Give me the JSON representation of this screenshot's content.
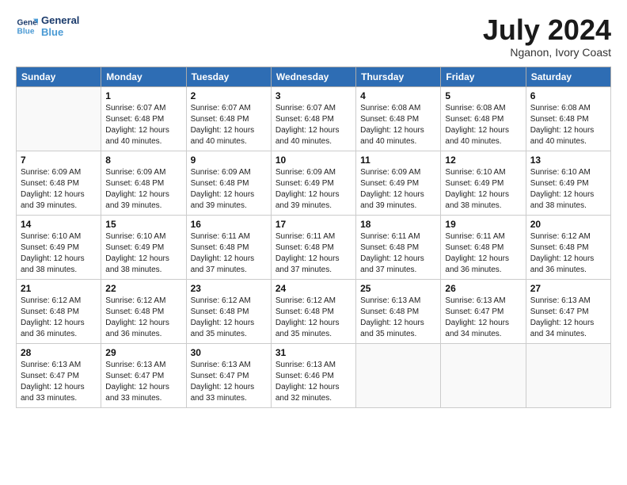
{
  "header": {
    "logo_line1": "General",
    "logo_line2": "Blue",
    "month": "July 2024",
    "location": "Nganon, Ivory Coast"
  },
  "weekdays": [
    "Sunday",
    "Monday",
    "Tuesday",
    "Wednesday",
    "Thursday",
    "Friday",
    "Saturday"
  ],
  "weeks": [
    [
      {
        "day": "",
        "info": ""
      },
      {
        "day": "1",
        "info": "Sunrise: 6:07 AM\nSunset: 6:48 PM\nDaylight: 12 hours\nand 40 minutes."
      },
      {
        "day": "2",
        "info": "Sunrise: 6:07 AM\nSunset: 6:48 PM\nDaylight: 12 hours\nand 40 minutes."
      },
      {
        "day": "3",
        "info": "Sunrise: 6:07 AM\nSunset: 6:48 PM\nDaylight: 12 hours\nand 40 minutes."
      },
      {
        "day": "4",
        "info": "Sunrise: 6:08 AM\nSunset: 6:48 PM\nDaylight: 12 hours\nand 40 minutes."
      },
      {
        "day": "5",
        "info": "Sunrise: 6:08 AM\nSunset: 6:48 PM\nDaylight: 12 hours\nand 40 minutes."
      },
      {
        "day": "6",
        "info": "Sunrise: 6:08 AM\nSunset: 6:48 PM\nDaylight: 12 hours\nand 40 minutes."
      }
    ],
    [
      {
        "day": "7",
        "info": "Sunrise: 6:09 AM\nSunset: 6:48 PM\nDaylight: 12 hours\nand 39 minutes."
      },
      {
        "day": "8",
        "info": "Sunrise: 6:09 AM\nSunset: 6:48 PM\nDaylight: 12 hours\nand 39 minutes."
      },
      {
        "day": "9",
        "info": "Sunrise: 6:09 AM\nSunset: 6:48 PM\nDaylight: 12 hours\nand 39 minutes."
      },
      {
        "day": "10",
        "info": "Sunrise: 6:09 AM\nSunset: 6:49 PM\nDaylight: 12 hours\nand 39 minutes."
      },
      {
        "day": "11",
        "info": "Sunrise: 6:09 AM\nSunset: 6:49 PM\nDaylight: 12 hours\nand 39 minutes."
      },
      {
        "day": "12",
        "info": "Sunrise: 6:10 AM\nSunset: 6:49 PM\nDaylight: 12 hours\nand 38 minutes."
      },
      {
        "day": "13",
        "info": "Sunrise: 6:10 AM\nSunset: 6:49 PM\nDaylight: 12 hours\nand 38 minutes."
      }
    ],
    [
      {
        "day": "14",
        "info": "Sunrise: 6:10 AM\nSunset: 6:49 PM\nDaylight: 12 hours\nand 38 minutes."
      },
      {
        "day": "15",
        "info": "Sunrise: 6:10 AM\nSunset: 6:49 PM\nDaylight: 12 hours\nand 38 minutes."
      },
      {
        "day": "16",
        "info": "Sunrise: 6:11 AM\nSunset: 6:48 PM\nDaylight: 12 hours\nand 37 minutes."
      },
      {
        "day": "17",
        "info": "Sunrise: 6:11 AM\nSunset: 6:48 PM\nDaylight: 12 hours\nand 37 minutes."
      },
      {
        "day": "18",
        "info": "Sunrise: 6:11 AM\nSunset: 6:48 PM\nDaylight: 12 hours\nand 37 minutes."
      },
      {
        "day": "19",
        "info": "Sunrise: 6:11 AM\nSunset: 6:48 PM\nDaylight: 12 hours\nand 36 minutes."
      },
      {
        "day": "20",
        "info": "Sunrise: 6:12 AM\nSunset: 6:48 PM\nDaylight: 12 hours\nand 36 minutes."
      }
    ],
    [
      {
        "day": "21",
        "info": "Sunrise: 6:12 AM\nSunset: 6:48 PM\nDaylight: 12 hours\nand 36 minutes."
      },
      {
        "day": "22",
        "info": "Sunrise: 6:12 AM\nSunset: 6:48 PM\nDaylight: 12 hours\nand 36 minutes."
      },
      {
        "day": "23",
        "info": "Sunrise: 6:12 AM\nSunset: 6:48 PM\nDaylight: 12 hours\nand 35 minutes."
      },
      {
        "day": "24",
        "info": "Sunrise: 6:12 AM\nSunset: 6:48 PM\nDaylight: 12 hours\nand 35 minutes."
      },
      {
        "day": "25",
        "info": "Sunrise: 6:13 AM\nSunset: 6:48 PM\nDaylight: 12 hours\nand 35 minutes."
      },
      {
        "day": "26",
        "info": "Sunrise: 6:13 AM\nSunset: 6:47 PM\nDaylight: 12 hours\nand 34 minutes."
      },
      {
        "day": "27",
        "info": "Sunrise: 6:13 AM\nSunset: 6:47 PM\nDaylight: 12 hours\nand 34 minutes."
      }
    ],
    [
      {
        "day": "28",
        "info": "Sunrise: 6:13 AM\nSunset: 6:47 PM\nDaylight: 12 hours\nand 33 minutes."
      },
      {
        "day": "29",
        "info": "Sunrise: 6:13 AM\nSunset: 6:47 PM\nDaylight: 12 hours\nand 33 minutes."
      },
      {
        "day": "30",
        "info": "Sunrise: 6:13 AM\nSunset: 6:47 PM\nDaylight: 12 hours\nand 33 minutes."
      },
      {
        "day": "31",
        "info": "Sunrise: 6:13 AM\nSunset: 6:46 PM\nDaylight: 12 hours\nand 32 minutes."
      },
      {
        "day": "",
        "info": ""
      },
      {
        "day": "",
        "info": ""
      },
      {
        "day": "",
        "info": ""
      }
    ]
  ]
}
